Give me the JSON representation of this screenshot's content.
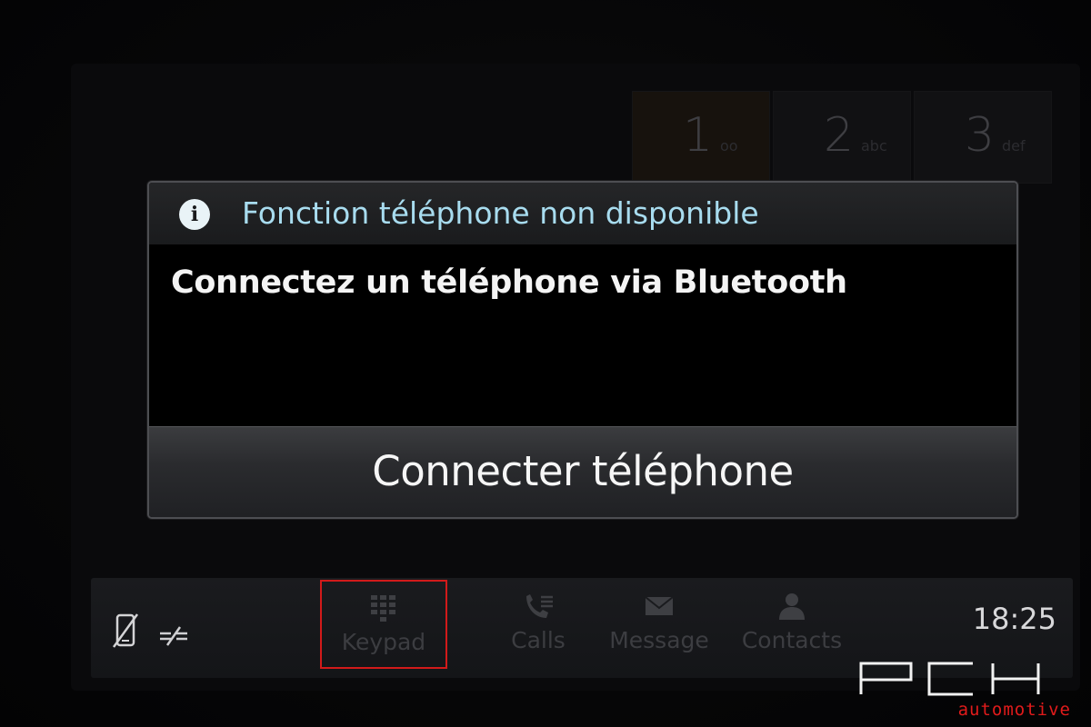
{
  "dialog": {
    "title": "Fonction téléphone non disponible",
    "message": "Connectez un téléphone via Bluetooth",
    "button_label": "Connecter téléphone",
    "icon": "info-icon",
    "title_color": "#a8dcef"
  },
  "background_keypad": {
    "keys": [
      {
        "digit": "1",
        "letters": "oo"
      },
      {
        "digit": "2",
        "letters": "abc"
      },
      {
        "digit": "3",
        "letters": "def"
      }
    ]
  },
  "bottom_bar": {
    "status_icons": [
      "phone-disconnected-icon",
      "bluetooth-disconnected-icon"
    ],
    "tabs": [
      {
        "label": "Keypad",
        "icon": "keypad-icon",
        "selected": true
      },
      {
        "label": "Calls",
        "icon": "calls-icon",
        "selected": false
      },
      {
        "label": "Message",
        "icon": "message-icon",
        "selected": false
      },
      {
        "label": "Contacts",
        "icon": "contacts-icon",
        "selected": false
      }
    ],
    "time": "18:25",
    "selected_color": "#d21a1a"
  },
  "watermark": {
    "brand": "PCH",
    "sub": "automotive",
    "sub_color": "#e11b1b"
  }
}
